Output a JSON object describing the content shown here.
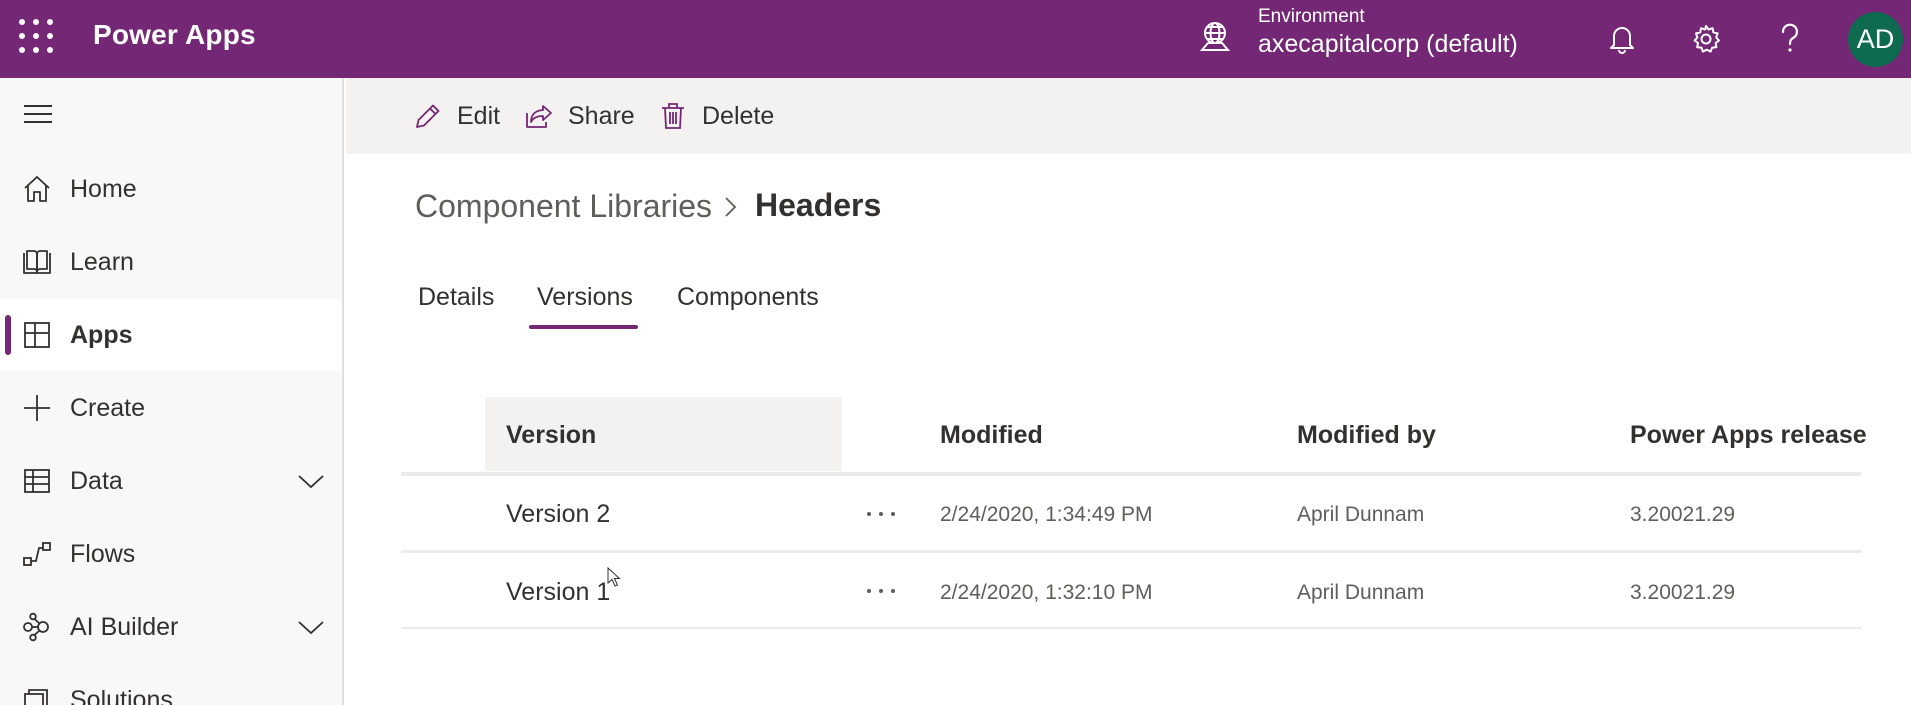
{
  "header": {
    "brand": "Power Apps",
    "environment_label": "Environment",
    "environment_name": "axecapitalcorp (default)",
    "avatar_initials": "AD"
  },
  "colors": {
    "brand": "#742774",
    "avatar": "#0f6b4f",
    "command_bar": "#f3f2f1"
  },
  "sidebar": {
    "items": [
      {
        "label": "Home",
        "icon": "home-icon"
      },
      {
        "label": "Learn",
        "icon": "book-icon"
      },
      {
        "label": "Apps",
        "icon": "apps-icon",
        "active": true
      },
      {
        "label": "Create",
        "icon": "plus-icon"
      },
      {
        "label": "Data",
        "icon": "table-icon",
        "expandable": true
      },
      {
        "label": "Flows",
        "icon": "flow-icon"
      },
      {
        "label": "AI Builder",
        "icon": "ai-builder-icon",
        "expandable": true
      },
      {
        "label": "Solutions",
        "icon": "solutions-icon"
      }
    ]
  },
  "toolbar": {
    "edit_label": "Edit",
    "share_label": "Share",
    "delete_label": "Delete"
  },
  "breadcrumb": {
    "parent": "Component Libraries",
    "current": "Headers"
  },
  "tabs": [
    {
      "label": "Details"
    },
    {
      "label": "Versions",
      "active": true
    },
    {
      "label": "Components"
    }
  ],
  "table": {
    "columns": [
      "Version",
      "Modified",
      "Modified by",
      "Power Apps release"
    ],
    "rows": [
      {
        "version": "Version 2",
        "modified": "2/24/2020, 1:34:49 PM",
        "modified_by": "April Dunnam",
        "release": "3.20021.29"
      },
      {
        "version": "Version 1",
        "modified": "2/24/2020, 1:32:10 PM",
        "modified_by": "April Dunnam",
        "release": "3.20021.29"
      }
    ]
  }
}
